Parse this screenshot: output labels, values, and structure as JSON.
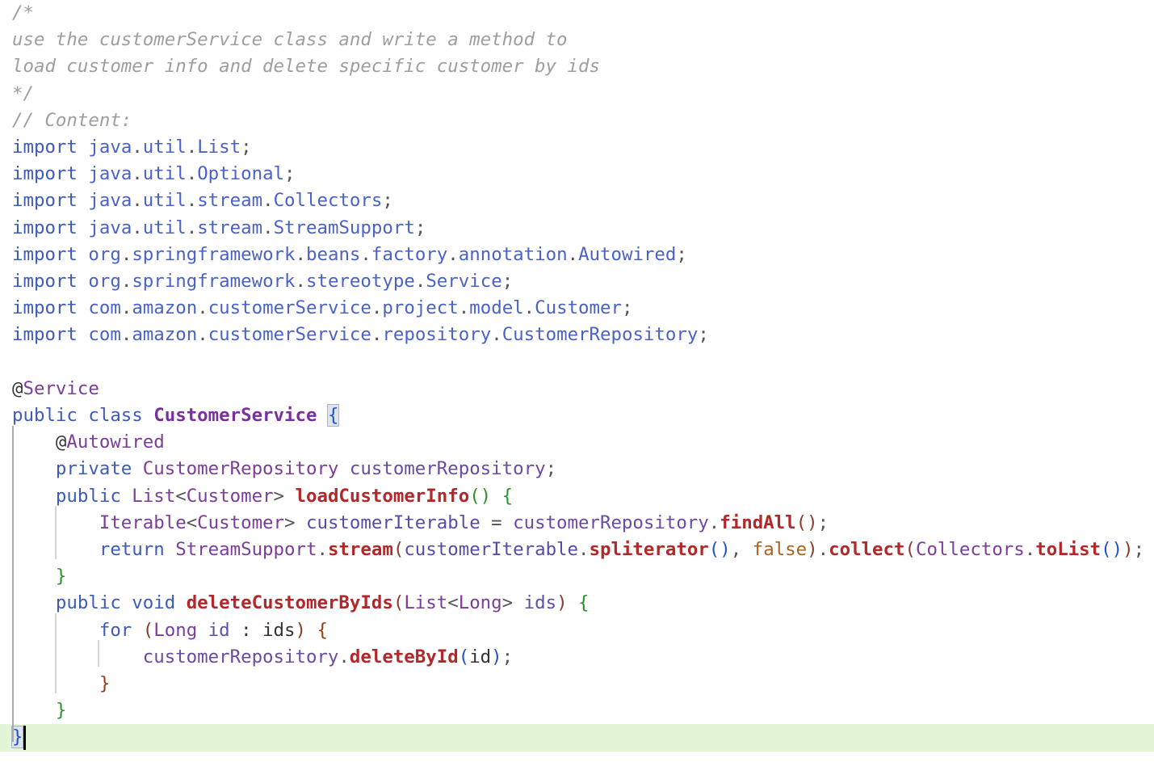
{
  "colors": {
    "background": "#ffffff",
    "comment": "#9e9e9e",
    "keyword": "#3d5bb8",
    "package": "#4a62c8",
    "type": "#7b3c9a",
    "classname": "#7b2f9e",
    "method_call": "#b0282a",
    "field": "#6a4aa3",
    "variable": "#5a4aa8",
    "param": "#5d4fa8",
    "plain": "#333333",
    "punct": "#555555",
    "paren1": "#8b3b2b",
    "paren2": "#2251c9",
    "brace1": "#1a55d4",
    "brace2": "#2f8e2f",
    "brace3": "#9b3a12",
    "boolean": "#a8621e",
    "annotation": "#7b3c9a",
    "current_line": "#e4f5d6"
  },
  "editor": {
    "lines": [
      {
        "tokens": [
          {
            "t": "/*",
            "c": "comment",
            "i": true
          }
        ]
      },
      {
        "tokens": [
          {
            "t": "use the customerService class and write a method to",
            "c": "comment",
            "i": true
          }
        ]
      },
      {
        "tokens": [
          {
            "t": "load customer info and delete specific customer by ids",
            "c": "comment",
            "i": true
          }
        ]
      },
      {
        "tokens": [
          {
            "t": "*/",
            "c": "comment",
            "i": true
          }
        ]
      },
      {
        "tokens": [
          {
            "t": "// Content:",
            "c": "comment",
            "i": true
          }
        ]
      },
      {
        "tokens": [
          {
            "t": "import ",
            "c": "keyword"
          },
          {
            "t": "java",
            "c": "package"
          },
          {
            "t": ".",
            "c": "punct"
          },
          {
            "t": "util",
            "c": "package"
          },
          {
            "t": ".",
            "c": "punct"
          },
          {
            "t": "List",
            "c": "package"
          },
          {
            "t": ";",
            "c": "punct"
          }
        ]
      },
      {
        "tokens": [
          {
            "t": "import ",
            "c": "keyword"
          },
          {
            "t": "java",
            "c": "package"
          },
          {
            "t": ".",
            "c": "punct"
          },
          {
            "t": "util",
            "c": "package"
          },
          {
            "t": ".",
            "c": "punct"
          },
          {
            "t": "Optional",
            "c": "package"
          },
          {
            "t": ";",
            "c": "punct"
          }
        ]
      },
      {
        "tokens": [
          {
            "t": "import ",
            "c": "keyword"
          },
          {
            "t": "java",
            "c": "package"
          },
          {
            "t": ".",
            "c": "punct"
          },
          {
            "t": "util",
            "c": "package"
          },
          {
            "t": ".",
            "c": "punct"
          },
          {
            "t": "stream",
            "c": "package"
          },
          {
            "t": ".",
            "c": "punct"
          },
          {
            "t": "Collectors",
            "c": "package"
          },
          {
            "t": ";",
            "c": "punct"
          }
        ]
      },
      {
        "tokens": [
          {
            "t": "import ",
            "c": "keyword"
          },
          {
            "t": "java",
            "c": "package"
          },
          {
            "t": ".",
            "c": "punct"
          },
          {
            "t": "util",
            "c": "package"
          },
          {
            "t": ".",
            "c": "punct"
          },
          {
            "t": "stream",
            "c": "package"
          },
          {
            "t": ".",
            "c": "punct"
          },
          {
            "t": "StreamSupport",
            "c": "package"
          },
          {
            "t": ";",
            "c": "punct"
          }
        ]
      },
      {
        "tokens": [
          {
            "t": "import ",
            "c": "keyword"
          },
          {
            "t": "org",
            "c": "package"
          },
          {
            "t": ".",
            "c": "punct"
          },
          {
            "t": "springframework",
            "c": "package"
          },
          {
            "t": ".",
            "c": "punct"
          },
          {
            "t": "beans",
            "c": "package"
          },
          {
            "t": ".",
            "c": "punct"
          },
          {
            "t": "factory",
            "c": "package"
          },
          {
            "t": ".",
            "c": "punct"
          },
          {
            "t": "annotation",
            "c": "package"
          },
          {
            "t": ".",
            "c": "punct"
          },
          {
            "t": "Autowired",
            "c": "package"
          },
          {
            "t": ";",
            "c": "punct"
          }
        ]
      },
      {
        "tokens": [
          {
            "t": "import ",
            "c": "keyword"
          },
          {
            "t": "org",
            "c": "package"
          },
          {
            "t": ".",
            "c": "punct"
          },
          {
            "t": "springframework",
            "c": "package"
          },
          {
            "t": ".",
            "c": "punct"
          },
          {
            "t": "stereotype",
            "c": "package"
          },
          {
            "t": ".",
            "c": "punct"
          },
          {
            "t": "Service",
            "c": "package"
          },
          {
            "t": ";",
            "c": "punct"
          }
        ]
      },
      {
        "tokens": [
          {
            "t": "import ",
            "c": "keyword"
          },
          {
            "t": "com",
            "c": "package"
          },
          {
            "t": ".",
            "c": "punct"
          },
          {
            "t": "amazon",
            "c": "package"
          },
          {
            "t": ".",
            "c": "punct"
          },
          {
            "t": "customerService",
            "c": "package"
          },
          {
            "t": ".",
            "c": "punct"
          },
          {
            "t": "project",
            "c": "package"
          },
          {
            "t": ".",
            "c": "punct"
          },
          {
            "t": "model",
            "c": "package"
          },
          {
            "t": ".",
            "c": "punct"
          },
          {
            "t": "Customer",
            "c": "package"
          },
          {
            "t": ";",
            "c": "punct"
          }
        ]
      },
      {
        "tokens": [
          {
            "t": "import ",
            "c": "keyword"
          },
          {
            "t": "com",
            "c": "package"
          },
          {
            "t": ".",
            "c": "punct"
          },
          {
            "t": "amazon",
            "c": "package"
          },
          {
            "t": ".",
            "c": "punct"
          },
          {
            "t": "customerService",
            "c": "package"
          },
          {
            "t": ".",
            "c": "punct"
          },
          {
            "t": "repository",
            "c": "package"
          },
          {
            "t": ".",
            "c": "punct"
          },
          {
            "t": "CustomerRepository",
            "c": "package"
          },
          {
            "t": ";",
            "c": "punct"
          }
        ]
      },
      {
        "tokens": []
      },
      {
        "tokens": [
          {
            "t": "@",
            "c": "plain"
          },
          {
            "t": "Service",
            "c": "annotation"
          }
        ]
      },
      {
        "tokens": [
          {
            "t": "public class ",
            "c": "keyword"
          },
          {
            "t": "CustomerService",
            "c": "classname",
            "b": true
          },
          {
            "t": " ",
            "c": "plain"
          },
          {
            "t": "{",
            "c": "brace1",
            "m": true
          }
        ]
      },
      {
        "tokens": [
          {
            "t": "    ",
            "c": "plain"
          },
          {
            "t": "@",
            "c": "plain"
          },
          {
            "t": "Autowired",
            "c": "annotation"
          }
        ]
      },
      {
        "tokens": [
          {
            "t": "    private ",
            "c": "keyword"
          },
          {
            "t": "CustomerRepository",
            "c": "type"
          },
          {
            "t": " ",
            "c": "plain"
          },
          {
            "t": "customerRepository",
            "c": "field"
          },
          {
            "t": ";",
            "c": "punct"
          }
        ]
      },
      {
        "tokens": [
          {
            "t": "    public ",
            "c": "keyword"
          },
          {
            "t": "List",
            "c": "type"
          },
          {
            "t": "<",
            "c": "punct"
          },
          {
            "t": "Customer",
            "c": "type"
          },
          {
            "t": "> ",
            "c": "punct"
          },
          {
            "t": "loadCustomerInfo",
            "c": "method_call",
            "b": true
          },
          {
            "t": "()",
            "c": "brace2"
          },
          {
            "t": " ",
            "c": "plain"
          },
          {
            "t": "{",
            "c": "brace2"
          }
        ]
      },
      {
        "tokens": [
          {
            "t": "        ",
            "c": "plain"
          },
          {
            "t": "Iterable",
            "c": "type"
          },
          {
            "t": "<",
            "c": "punct"
          },
          {
            "t": "Customer",
            "c": "type"
          },
          {
            "t": "> ",
            "c": "punct"
          },
          {
            "t": "customerIterable",
            "c": "variable"
          },
          {
            "t": " = ",
            "c": "punct"
          },
          {
            "t": "customerRepository",
            "c": "field"
          },
          {
            "t": ".",
            "c": "punct"
          },
          {
            "t": "findAll",
            "c": "method_call",
            "b": true
          },
          {
            "t": "()",
            "c": "paren1"
          },
          {
            "t": ";",
            "c": "punct"
          }
        ]
      },
      {
        "tokens": [
          {
            "t": "        return ",
            "c": "keyword"
          },
          {
            "t": "StreamSupport",
            "c": "type"
          },
          {
            "t": ".",
            "c": "punct"
          },
          {
            "t": "stream",
            "c": "method_call",
            "b": true
          },
          {
            "t": "(",
            "c": "paren1"
          },
          {
            "t": "customerIterable",
            "c": "variable"
          },
          {
            "t": ".",
            "c": "punct"
          },
          {
            "t": "spliterator",
            "c": "method_call",
            "b": true
          },
          {
            "t": "()",
            "c": "paren2"
          },
          {
            "t": ", ",
            "c": "punct"
          },
          {
            "t": "false",
            "c": "boolean"
          },
          {
            "t": ")",
            "c": "paren1"
          },
          {
            "t": ".",
            "c": "punct"
          },
          {
            "t": "collect",
            "c": "method_call",
            "b": true
          },
          {
            "t": "(",
            "c": "paren1"
          },
          {
            "t": "Collectors",
            "c": "type"
          },
          {
            "t": ".",
            "c": "punct"
          },
          {
            "t": "toList",
            "c": "method_call",
            "b": true
          },
          {
            "t": "()",
            "c": "paren2"
          },
          {
            "t": ")",
            "c": "paren1"
          },
          {
            "t": ";",
            "c": "punct"
          }
        ]
      },
      {
        "tokens": [
          {
            "t": "    ",
            "c": "plain"
          },
          {
            "t": "}",
            "c": "brace2"
          }
        ]
      },
      {
        "tokens": [
          {
            "t": "    public void ",
            "c": "keyword"
          },
          {
            "t": "deleteCustomerByIds",
            "c": "method_call",
            "b": true
          },
          {
            "t": "(",
            "c": "paren1"
          },
          {
            "t": "List",
            "c": "type"
          },
          {
            "t": "<",
            "c": "punct"
          },
          {
            "t": "Long",
            "c": "type"
          },
          {
            "t": "> ",
            "c": "punct"
          },
          {
            "t": "ids",
            "c": "param"
          },
          {
            "t": ")",
            "c": "paren1"
          },
          {
            "t": " ",
            "c": "plain"
          },
          {
            "t": "{",
            "c": "brace2"
          }
        ]
      },
      {
        "tokens": [
          {
            "t": "        for ",
            "c": "keyword"
          },
          {
            "t": "(",
            "c": "paren1"
          },
          {
            "t": "Long",
            "c": "type"
          },
          {
            "t": " ",
            "c": "plain"
          },
          {
            "t": "id",
            "c": "param"
          },
          {
            "t": " : ",
            "c": "plain"
          },
          {
            "t": "ids",
            "c": "plain"
          },
          {
            "t": ")",
            "c": "paren1"
          },
          {
            "t": " ",
            "c": "plain"
          },
          {
            "t": "{",
            "c": "brace3"
          }
        ]
      },
      {
        "tokens": [
          {
            "t": "            ",
            "c": "plain"
          },
          {
            "t": "customerRepository",
            "c": "field"
          },
          {
            "t": ".",
            "c": "punct"
          },
          {
            "t": "deleteById",
            "c": "method_call",
            "b": true
          },
          {
            "t": "(",
            "c": "paren2"
          },
          {
            "t": "id",
            "c": "plain"
          },
          {
            "t": ")",
            "c": "paren2"
          },
          {
            "t": ";",
            "c": "punct"
          }
        ]
      },
      {
        "tokens": [
          {
            "t": "        ",
            "c": "plain"
          },
          {
            "t": "}",
            "c": "brace3"
          }
        ]
      },
      {
        "tokens": [
          {
            "t": "    ",
            "c": "plain"
          },
          {
            "t": "}",
            "c": "brace2"
          }
        ]
      },
      {
        "tokens": [
          {
            "t": "}",
            "c": "brace1",
            "m": true
          }
        ],
        "current": true,
        "caret": true
      }
    ]
  }
}
